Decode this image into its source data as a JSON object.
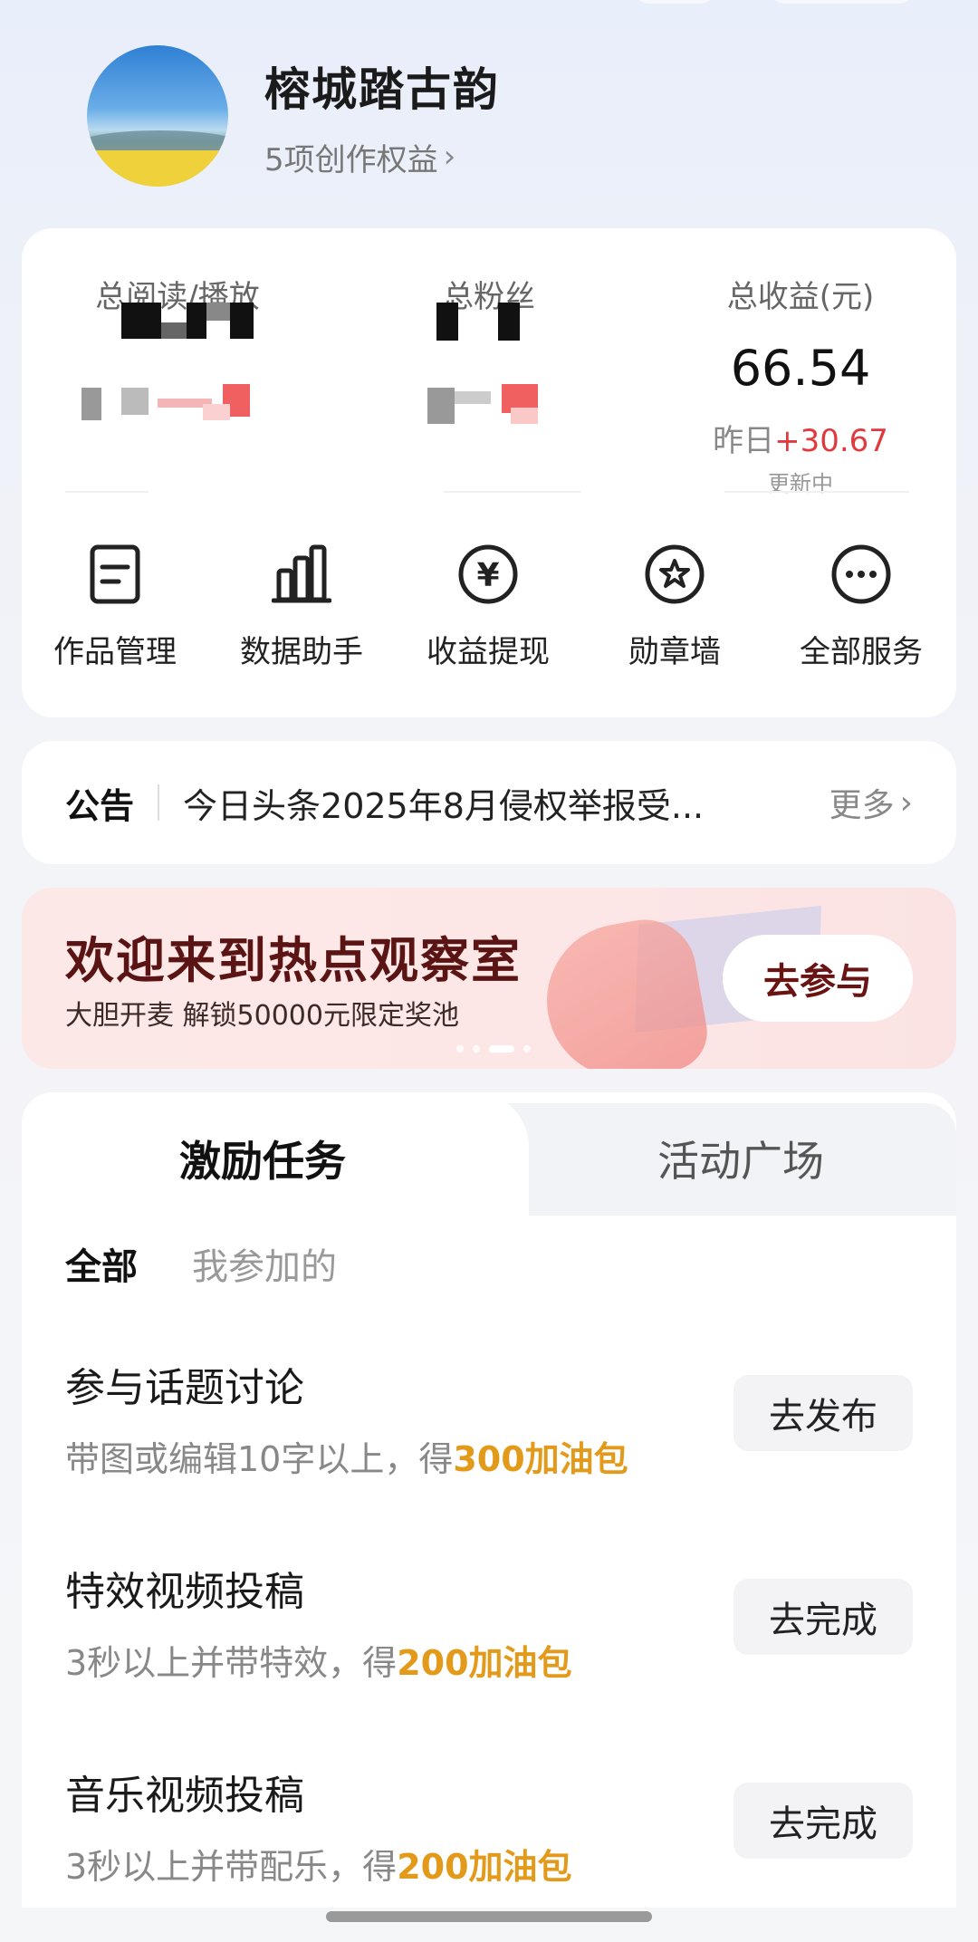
{
  "profile": {
    "username": "榕城踏古韵",
    "benefits": "5项创作权益",
    "benefits_chevron": "›"
  },
  "stats": {
    "reads": {
      "label": "总阅读/播放"
    },
    "fans": {
      "label": "总粉丝"
    },
    "earnings": {
      "label": "总收益(元)",
      "value": "66.54",
      "delta_prefix": "昨日",
      "delta": "+30.67",
      "status": "更新中"
    }
  },
  "services": [
    {
      "label": "作品管理",
      "icon": "document-icon"
    },
    {
      "label": "数据助手",
      "icon": "bar-chart-icon"
    },
    {
      "label": "收益提现",
      "icon": "yuan-coin-icon"
    },
    {
      "label": "勋章墙",
      "icon": "badge-icon"
    },
    {
      "label": "全部服务",
      "icon": "more-icon"
    }
  ],
  "notice": {
    "tag": "公告",
    "text": "今日头条2025年8月侵权举报受...",
    "more": "更多",
    "more_chevron": "›"
  },
  "banner": {
    "title": "欢迎来到热点观察室",
    "subtitle": "大胆开麦 解锁50000元限定奖池",
    "button": "去参与"
  },
  "tasks": {
    "tabs": [
      "激励任务",
      "活动广场"
    ],
    "filters": [
      "全部",
      "我参加的"
    ],
    "items": [
      {
        "title": "参与话题讨论",
        "desc": "带图或编辑10字以上，得",
        "reward": "300加油包",
        "button": "去发布"
      },
      {
        "title": "特效视频投稿",
        "desc": "3秒以上并带特效，得",
        "reward": "200加油包",
        "button": "去完成"
      },
      {
        "title": "音乐视频投稿",
        "desc": "3秒以上并带配乐，得",
        "reward": "200加油包",
        "button": "去完成"
      }
    ]
  },
  "colors": {
    "accent_red": "#e0393e",
    "reward_orange": "#e39a1a",
    "banner_title": "#5a1414"
  }
}
